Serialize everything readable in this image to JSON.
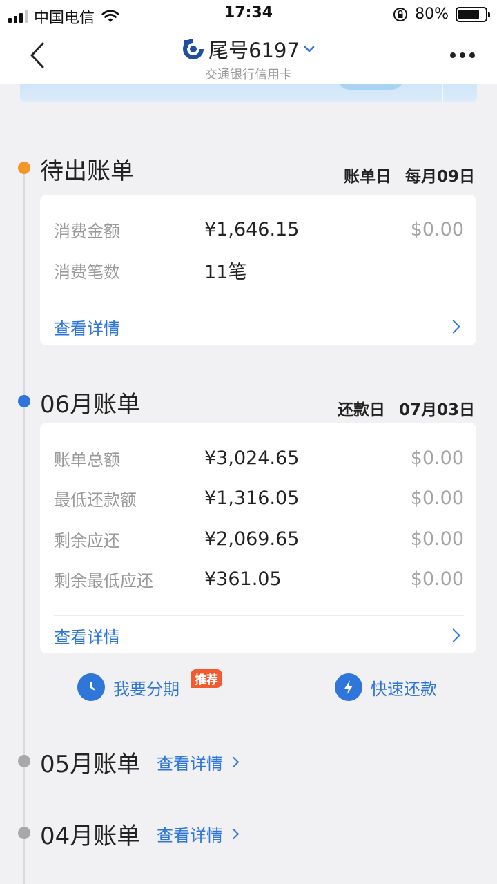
{
  "status_bar": {
    "carrier": "中国电信",
    "time": "17:34",
    "battery": "80%",
    "battery_level": 0.8
  },
  "nav": {
    "title": "尾号6197",
    "subtitle": "交通银行信用卡"
  },
  "pending_bill": {
    "title": "待出账单",
    "date_label": "账单日",
    "date_value": "每月09日",
    "rows": [
      {
        "label": "消费金额",
        "amount": "¥1,646.15",
        "paid": "$0.00"
      },
      {
        "label": "消费笔数",
        "amount": "11笔",
        "paid": ""
      }
    ],
    "detail_label": "查看详情"
  },
  "june_bill": {
    "title": "06月账单",
    "date_label": "还款日",
    "date_value": "07月03日",
    "rows": [
      {
        "label": "账单总额",
        "amount": "¥3,024.65",
        "paid": "$0.00"
      },
      {
        "label": "最低还款额",
        "amount": "¥1,316.05",
        "paid": "$0.00"
      },
      {
        "label": "剩余应还",
        "amount": "¥2,069.65",
        "paid": "$0.00"
      },
      {
        "label": "剩余最低应还",
        "amount": "¥361.05",
        "paid": "$0.00"
      }
    ],
    "detail_label": "查看详情"
  },
  "actions": {
    "installment": "我要分期",
    "installment_badge": "推荐",
    "quick_repay": "快速还款"
  },
  "past_bills": [
    {
      "title": "05月账单",
      "link": "查看详情"
    },
    {
      "title": "04月账单",
      "link": "查看详情"
    }
  ],
  "colors": {
    "accent": "#2e76d9",
    "pending_dot": "#f5962a",
    "badge": "#f35a30"
  }
}
